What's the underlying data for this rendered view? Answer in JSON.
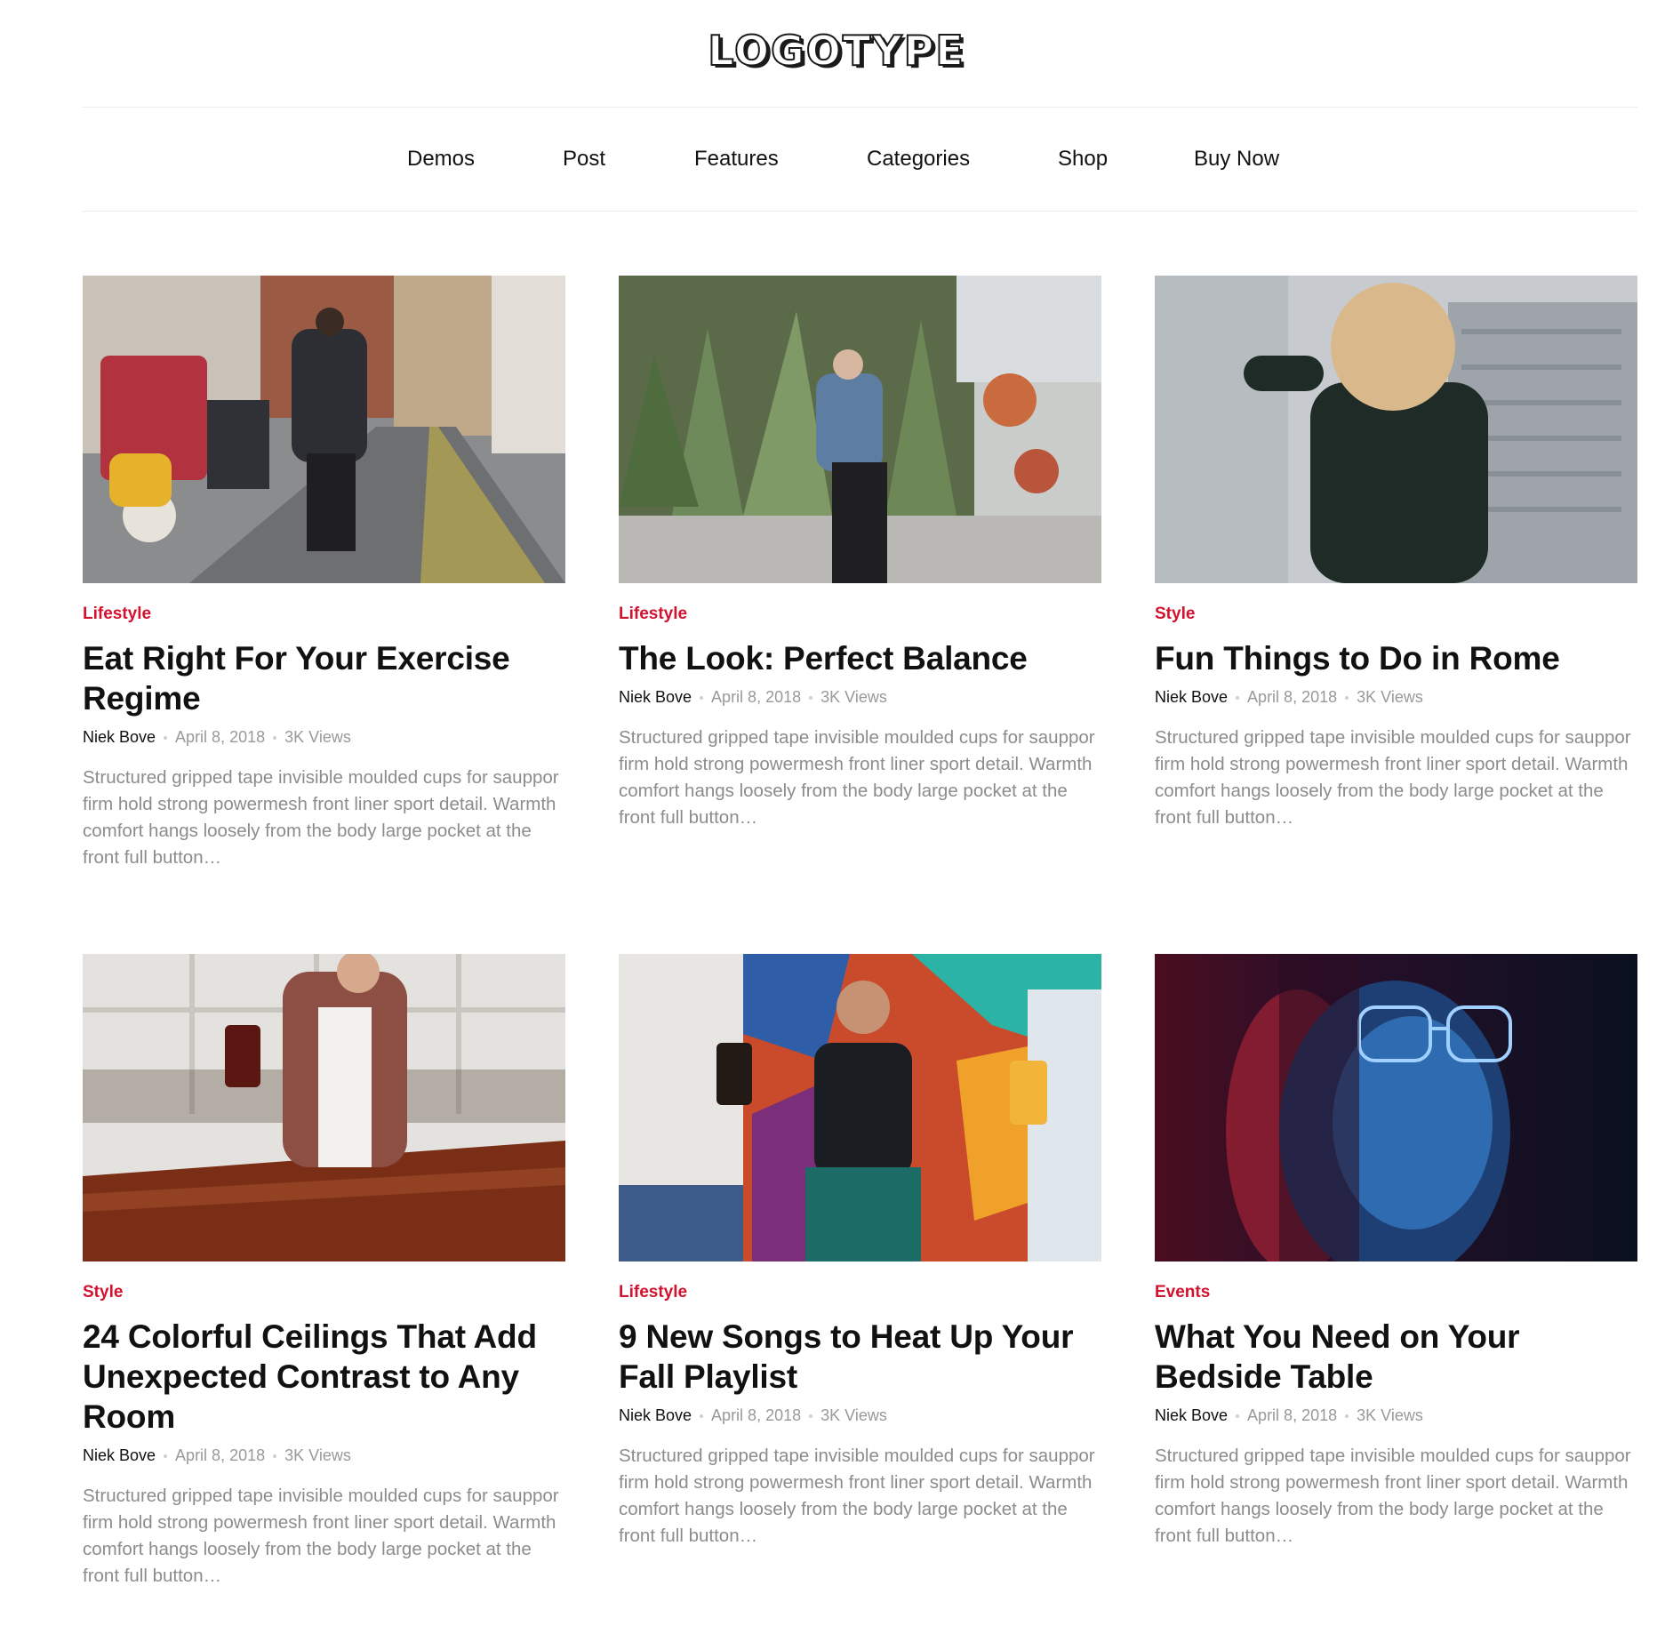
{
  "site": {
    "logo": "LOGOTYPE"
  },
  "nav": {
    "items": [
      {
        "label": "Demos"
      },
      {
        "label": "Post"
      },
      {
        "label": "Features"
      },
      {
        "label": "Categories"
      },
      {
        "label": "Shop"
      },
      {
        "label": "Buy Now"
      }
    ]
  },
  "posts": [
    {
      "category": "Lifestyle",
      "title": "Eat Right For Your Exercise Regime",
      "author": "Niek Bove",
      "date": "April 8, 2018",
      "views": "3K Views",
      "excerpt": "Structured gripped tape invisible moulded cups for sauppor firm hold strong powermesh front liner sport detail. Warmth comfort hangs loosely from the body large pocket at the front full button…"
    },
    {
      "category": "Lifestyle",
      "title": "The Look: Perfect Balance",
      "author": "Niek Bove",
      "date": "April 8, 2018",
      "views": "3K Views",
      "excerpt": "Structured gripped tape invisible moulded cups for sauppor firm hold strong powermesh front liner sport detail. Warmth comfort hangs loosely from the body large pocket at the front full button…"
    },
    {
      "category": "Style",
      "title": "Fun Things to Do in Rome",
      "author": "Niek Bove",
      "date": "April 8, 2018",
      "views": "3K Views",
      "excerpt": "Structured gripped tape invisible moulded cups for sauppor firm hold strong powermesh front liner sport detail. Warmth comfort hangs loosely from the body large pocket at the front full button…"
    },
    {
      "category": "Style",
      "title": "24 Colorful Ceilings That Add Unexpected Contrast to Any Room",
      "author": "Niek Bove",
      "date": "April 8, 2018",
      "views": "3K Views",
      "excerpt": "Structured gripped tape invisible moulded cups for sauppor firm hold strong powermesh front liner sport detail. Warmth comfort hangs loosely from the body large pocket at the front full button…"
    },
    {
      "category": "Lifestyle",
      "title": "9 New Songs to Heat Up Your Fall Playlist",
      "author": "Niek Bove",
      "date": "April 8, 2018",
      "views": "3K Views",
      "excerpt": "Structured gripped tape invisible moulded cups for sauppor firm hold strong powermesh front liner sport detail. Warmth comfort hangs loosely from the body large pocket at the front full button…"
    },
    {
      "category": "Events",
      "title": "What You Need on Your Bedside Table",
      "author": "Niek Bove",
      "date": "April 8, 2018",
      "views": "3K Views",
      "excerpt": "Structured gripped tape invisible moulded cups for sauppor firm hold strong powermesh front liner sport detail. Warmth comfort hangs loosely from the body large pocket at the front full button…"
    }
  ],
  "colors": {
    "category": "#d2122e",
    "muted": "#8c8c8c",
    "text": "#111111"
  }
}
